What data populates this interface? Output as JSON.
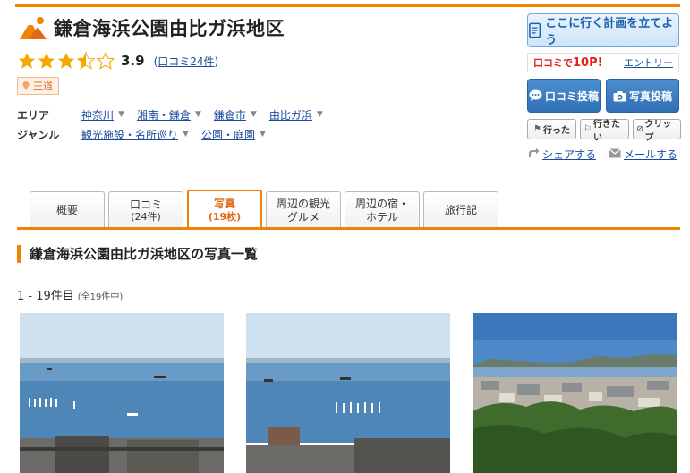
{
  "header": {
    "title": "鎌倉海浜公園由比ガ浜地区",
    "rating": {
      "stars": 3.5,
      "score": "3.9",
      "review_link": "口コミ24件"
    },
    "badge": "王道"
  },
  "info": {
    "area_label": "エリア",
    "area_items": [
      "神奈川",
      "湘南・鎌倉",
      "鎌倉市",
      "由比ガ浜"
    ],
    "genre_label": "ジャンル",
    "genre_items": [
      "観光施設・名所巡り",
      "公園・庭園"
    ]
  },
  "sidebar": {
    "plan_button": "ここに行く計画を立てよう",
    "points_prefix": "口コミで",
    "points_value": "10P!",
    "entry_link": "エントリー",
    "review_post": "口コミ投稿",
    "photo_post": "写真投稿",
    "went": "行った",
    "want": "行きたい",
    "clip": "クリップ",
    "share": "シェアする",
    "mail": "メールする"
  },
  "tabs": [
    {
      "label": "概要",
      "sub": ""
    },
    {
      "label": "口コミ",
      "sub": "(24件)"
    },
    {
      "label": "写真",
      "sub": "(19枚)"
    },
    {
      "label": "周辺の観光",
      "sub": "グルメ"
    },
    {
      "label": "周辺の宿・",
      "sub": "ホテル"
    },
    {
      "label": "旅行記",
      "sub": ""
    }
  ],
  "active_tab": "写真",
  "section_title": "鎌倉海浜公園由比ガ浜地区の写真一覧",
  "count": {
    "range": "1 - 19件目",
    "total": "(全19件中)"
  },
  "colors": {
    "accent": "#f08300",
    "link": "#1a4a9c",
    "button_blue": "#2f6fb4"
  }
}
